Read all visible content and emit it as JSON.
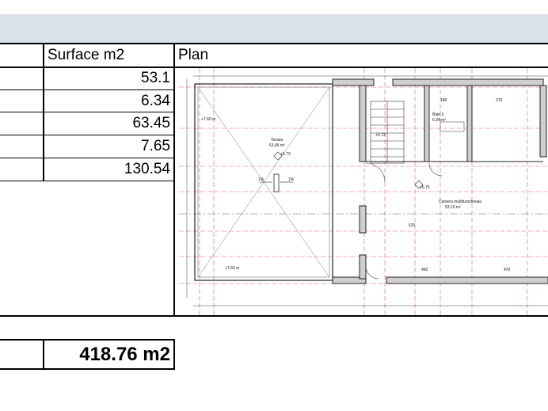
{
  "table": {
    "headers": {
      "surface": "Surface m2",
      "plan": "Plan"
    },
    "rows": [
      {
        "surface": "53.1"
      },
      {
        "surface": "6.34"
      },
      {
        "surface": "63.45"
      },
      {
        "surface": "7.65"
      },
      {
        "surface": "130.54"
      }
    ],
    "total": "418.76 m2"
  },
  "plan_labels": {
    "terasa": "Terasa",
    "terasa_area": "63,45 m²",
    "baie": "Baie 3",
    "baie_area": "6,34 m²",
    "camera": "Camera multifunctionala",
    "camera_area": "53,10 m²",
    "level_a": "+7.60 m",
    "level_b": "+7.60 m",
    "mark_a": "+6.73",
    "mark_b": "+6.73",
    "mark_c": "+6.75",
    "slope_a": "1%",
    "slope_b": "1%",
    "dim_a": "180",
    "dim_b": "270",
    "dim_c": "460",
    "dim_d": "470",
    "dim_e": "520"
  }
}
